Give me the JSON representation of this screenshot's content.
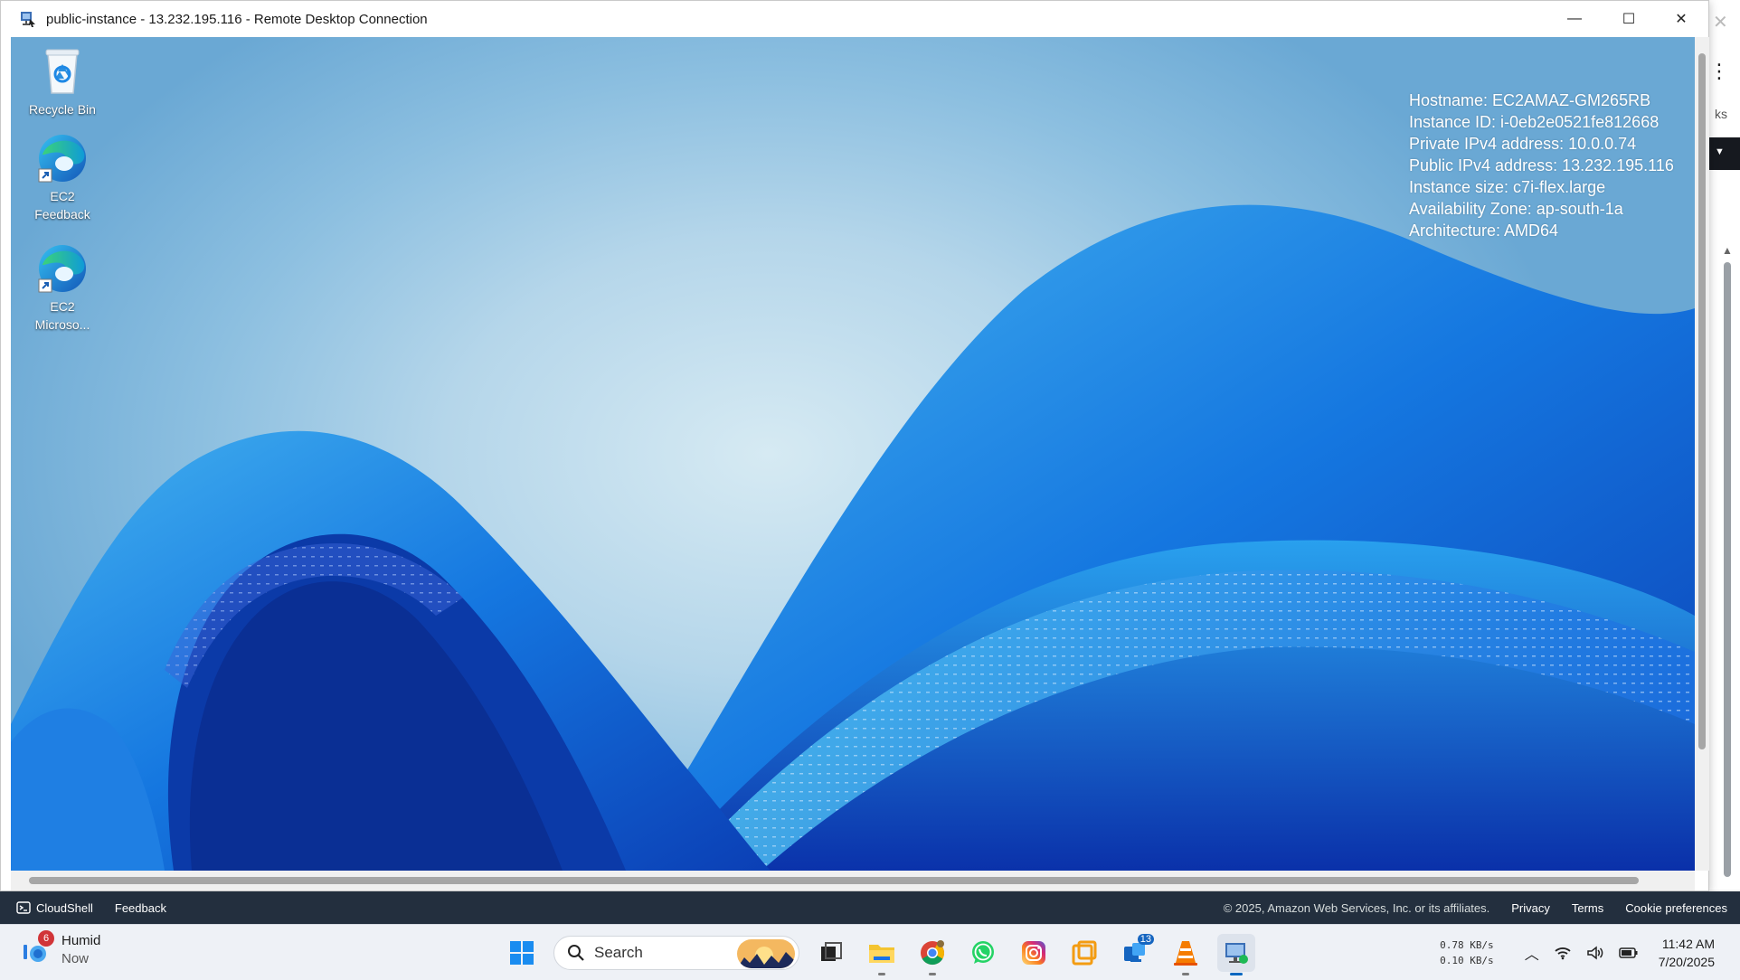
{
  "window": {
    "title": "public-instance - 13.232.195.116 - Remote Desktop Connection",
    "controls": {
      "minimize": "—",
      "maximize": "☐",
      "close": "✕"
    }
  },
  "desktop_icons": [
    {
      "label": "Recycle Bin"
    },
    {
      "label": "EC2 Feedback"
    },
    {
      "label": "EC2 Microso..."
    }
  ],
  "sysinfo": {
    "hostname": "Hostname: EC2AMAZ-GM265RB",
    "instance_id": "Instance ID: i-0eb2e0521fe812668",
    "private_ip": "Private IPv4 address: 10.0.0.74",
    "public_ip": "Public IPv4 address: 13.232.195.116",
    "instance_size": "Instance size: c7i-flex.large",
    "availability_zone": "Availability Zone: ap-south-1a",
    "architecture": "Architecture: AMD64"
  },
  "background_window": {
    "partial_text": "ks"
  },
  "aws_footer": {
    "cloudshell": "CloudShell",
    "feedback": "Feedback",
    "copyright": "© 2025, Amazon Web Services, Inc. or its affiliates.",
    "privacy": "Privacy",
    "terms": "Terms",
    "cookie_preferences": "Cookie preferences"
  },
  "taskbar": {
    "weather": {
      "badge": "6",
      "condition": "Humid",
      "time": "Now"
    },
    "search_label": "Search",
    "teams_badge": "13",
    "net_speed_up": "0.78 KB/s",
    "net_speed_down": "0.10 KB/s",
    "time": "11:42 AM",
    "date": "7/20/2025"
  }
}
